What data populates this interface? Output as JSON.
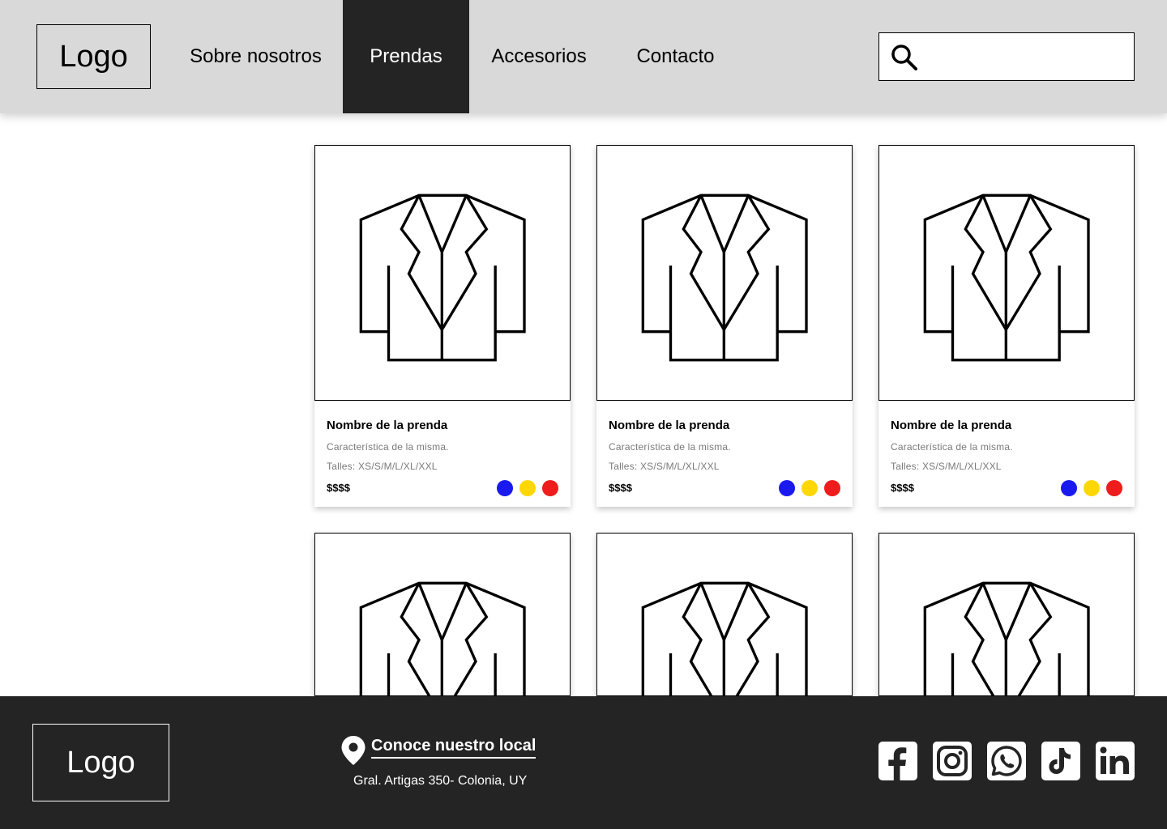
{
  "header": {
    "logo": "Logo",
    "nav": [
      {
        "label": "Sobre nosotros",
        "active": false
      },
      {
        "label": "Prendas",
        "active": true
      },
      {
        "label": "Accesorios",
        "active": false
      },
      {
        "label": "Contacto",
        "active": false
      }
    ],
    "search": {
      "placeholder": "",
      "value": ""
    }
  },
  "products": [
    {
      "name": "Nombre de la prenda",
      "description": "Característica de la misma.",
      "sizes": "Talles: XS/S/M/L/XL/XXL",
      "price": "$$$$",
      "colors": [
        "#1a1af0",
        "#ffd700",
        "#ee1c1c"
      ]
    },
    {
      "name": "Nombre de la prenda",
      "description": "Característica de la misma.",
      "sizes": "Talles: XS/S/M/L/XL/XXL",
      "price": "$$$$",
      "colors": [
        "#1a1af0",
        "#ffd700",
        "#ee1c1c"
      ]
    },
    {
      "name": "Nombre de la prenda",
      "description": "Característica de la misma.",
      "sizes": "Talles: XS/S/M/L/XL/XXL",
      "price": "$$$$",
      "colors": [
        "#1a1af0",
        "#ffd700",
        "#ee1c1c"
      ]
    },
    {
      "name": "",
      "description": "",
      "sizes": "",
      "price": "",
      "colors": []
    },
    {
      "name": "",
      "description": "",
      "sizes": "",
      "price": "",
      "colors": []
    },
    {
      "name": "",
      "description": "",
      "sizes": "",
      "price": "",
      "colors": []
    }
  ],
  "footer": {
    "logo": "Logo",
    "location_title": "Conoce nuestro local",
    "address": "Gral. Artigas 350- Colonia, UY",
    "socials": [
      "facebook-icon",
      "instagram-icon",
      "whatsapp-icon",
      "tiktok-icon",
      "linkedin-icon"
    ]
  },
  "colors": {
    "header_bg": "#d9d9d9",
    "active_nav": "#242424",
    "footer_bg": "#242424"
  }
}
